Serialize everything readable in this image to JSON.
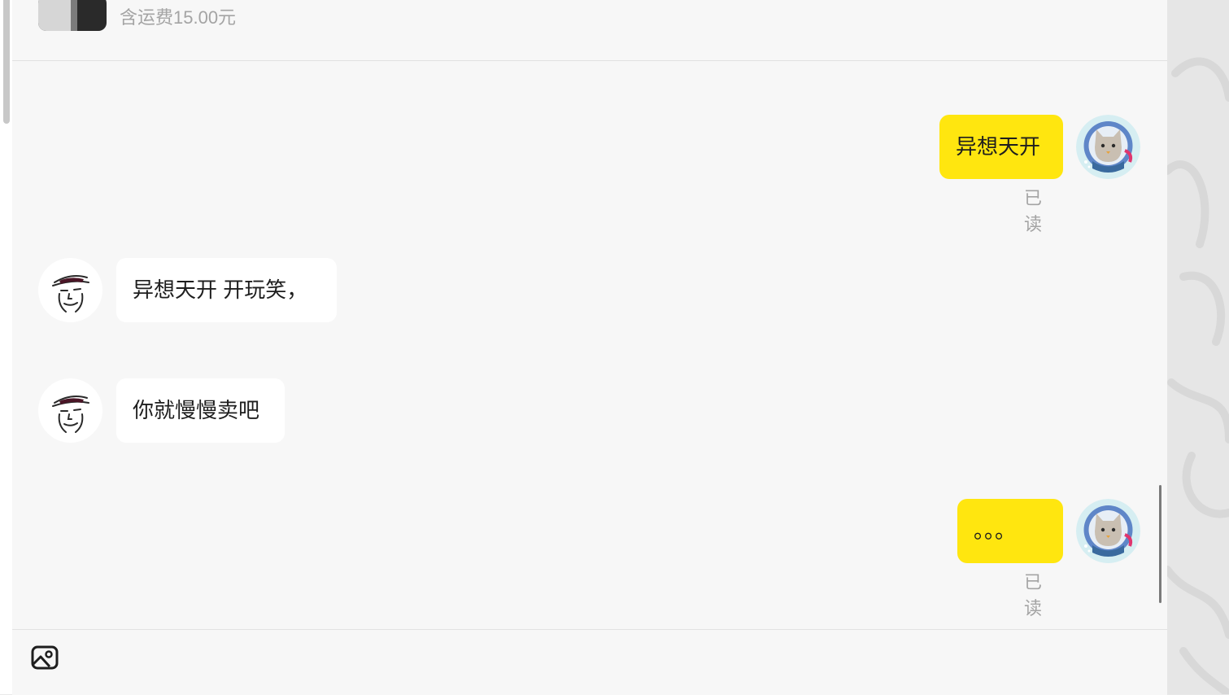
{
  "header": {
    "shipping_text": "含运费15.00元"
  },
  "messages": [
    {
      "sender": "me",
      "text": "异想天开",
      "status": "已读"
    },
    {
      "sender": "them",
      "text": "异想天开 开玩笑，"
    },
    {
      "sender": "them",
      "text": "你就慢慢卖吧"
    },
    {
      "sender": "me",
      "text": "。。。",
      "status": "已读"
    }
  ],
  "icons": {
    "me_avatar": "cat-astronaut-avatar-icon",
    "them_avatar": "sketch-face-avatar-icon",
    "image_button": "image-upload-icon"
  },
  "colors": {
    "my_bubble": "#ffe60f",
    "their_bubble": "#ffffff",
    "panel_background": "#f7f7f7",
    "muted_text": "#a4a4a4"
  }
}
